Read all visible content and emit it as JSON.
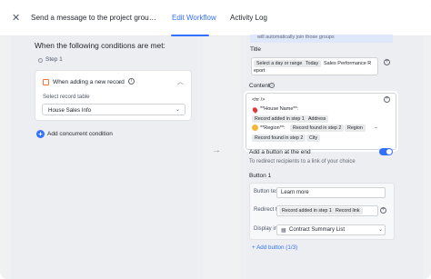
{
  "header": {
    "title": "Send a message to the project grou…",
    "tabs": [
      {
        "label": "Edit Workflow",
        "active": true
      },
      {
        "label": "Activity Log",
        "active": false
      }
    ]
  },
  "left": {
    "conditions_title": "When the following conditions are met:",
    "step_label": "Step 1",
    "trigger_label": "When adding a new record",
    "select_record_table_label": "Select record table",
    "table_value": "House Sales Info",
    "add_concurrent_label": "Add concurrent condition"
  },
  "right": {
    "note": "will automatically join those groups",
    "title_label": "Title",
    "title_chips": {
      "day_range": "Select a day or range",
      "today": "Today",
      "report_text": "Sales Performance R",
      "report_wrap": "eport"
    },
    "content_label": "Content",
    "content": {
      "hr": "<hr />",
      "house_name": "**House Name**:",
      "record_added_step1": "Record added in step 1",
      "address": "Address",
      "region_label": "**Region**:",
      "record_found_step2": "Record found in step 2",
      "region": "Region",
      "dash": "–",
      "city": "City"
    },
    "add_button_end_label": "Add a button at the end",
    "add_button_end_toggle": true,
    "redirect_hint": "To redirect recipients to a link of your choice",
    "button_section_title": "Button 1",
    "button_text_label": "Button text",
    "button_text_value": "Learn more",
    "redirect_label": "Redirect to",
    "redirect_chip": "Record added in step 1",
    "redirect_link": "Record link",
    "display_in_label": "Display in",
    "display_in_value": "Contract Summary List",
    "add_button_label": "+ Add button (1/3)"
  },
  "colors": {
    "accent": "#3370ff",
    "toggle_on": "#3370ff"
  }
}
